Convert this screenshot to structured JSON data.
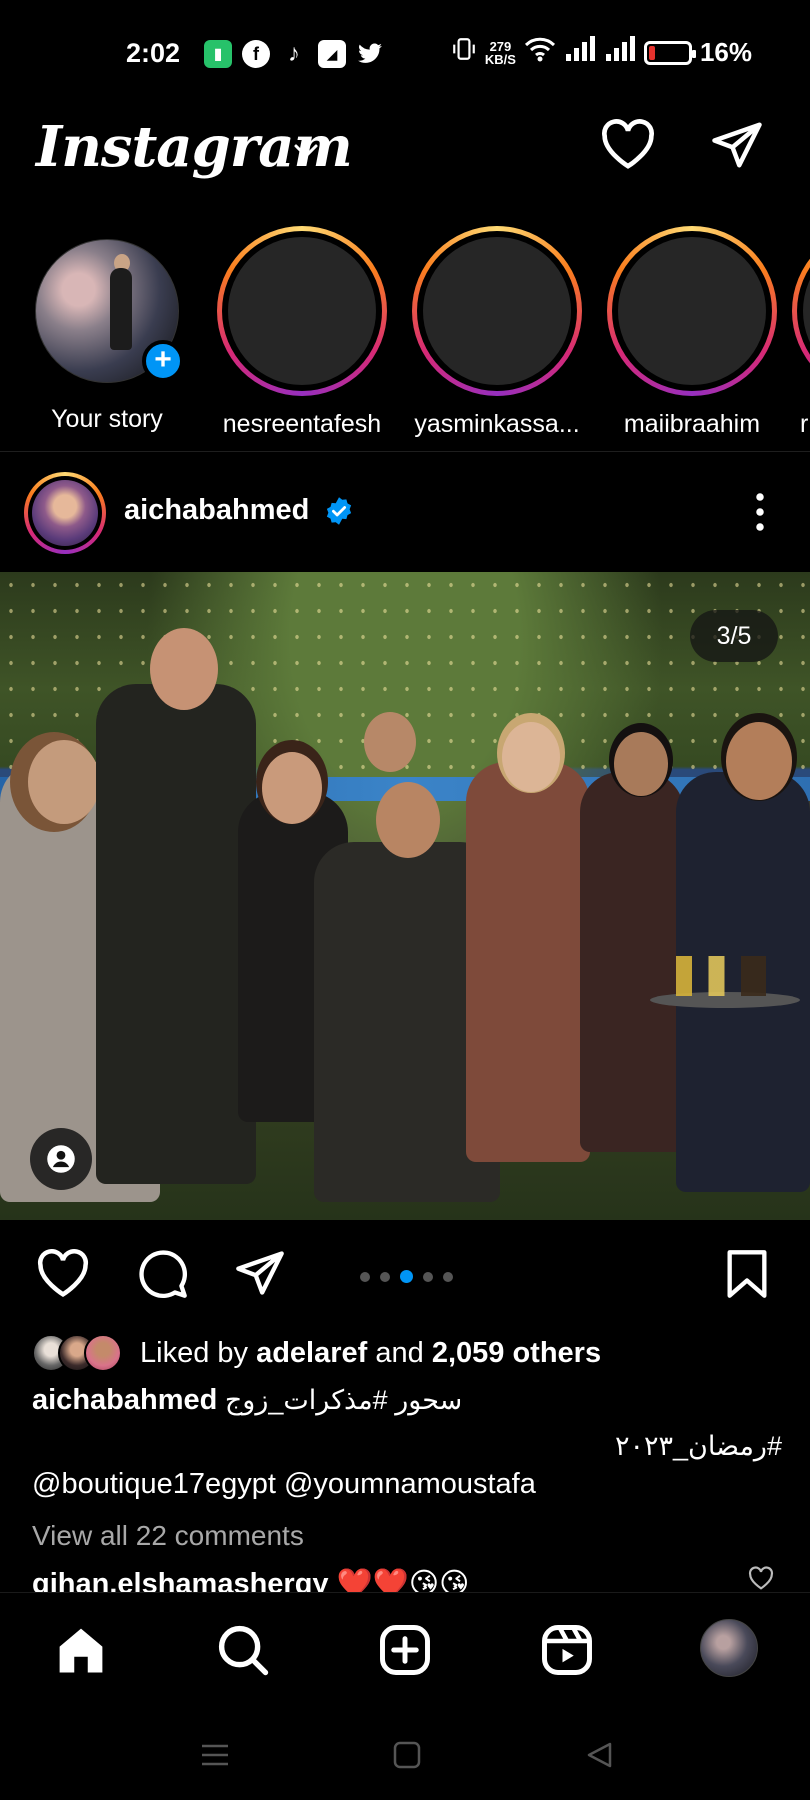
{
  "status_bar": {
    "time": "2:02",
    "net_speed_value": "279",
    "net_speed_unit": "KB/S",
    "battery": "16%",
    "battery_level": 0.16,
    "app_icons": [
      "battery-saver-icon",
      "facebook-icon",
      "tiktok-icon",
      "gallery-icon",
      "twitter-icon"
    ]
  },
  "header": {
    "logo": "Instagram",
    "icons": [
      "chevron-down-icon",
      "heart-icon",
      "send-icon"
    ]
  },
  "stories": [
    {
      "label": "Your story",
      "own": true
    },
    {
      "label": "nesreentafesh"
    },
    {
      "label": "yasminkassa..."
    },
    {
      "label": "maiibraahim"
    },
    {
      "label": "r"
    }
  ],
  "post": {
    "username": "aichabahmed",
    "verified": true,
    "counter": "3/5",
    "carousel_total": 5,
    "carousel_active": 3,
    "liked_by_prefix": "Liked by",
    "liked_by_user": "adelaref",
    "liked_by_and": "and",
    "liked_by_others": "2,059 others",
    "caption_user": "aichabahmed",
    "caption_text": "سحور #مذكرات_زوج",
    "caption_line2": "#رمضان_٢٠٢٣",
    "mentions": "@boutique17egypt @youmnamoustafa",
    "view_comments": "View all 22 comments",
    "comment_user": "gihan.elshamasherqy",
    "comment_text": "❤️❤️😘😘"
  },
  "colors": {
    "accent": "#0095f6",
    "background": "#000000",
    "muted_text": "#a8a8a8",
    "battery_low": "#e5322d"
  },
  "bottom_nav": [
    "home-icon",
    "search-icon",
    "create-icon",
    "reels-icon",
    "profile-avatar"
  ],
  "system_nav": [
    "menu-icon",
    "home-square-icon",
    "back-icon"
  ]
}
